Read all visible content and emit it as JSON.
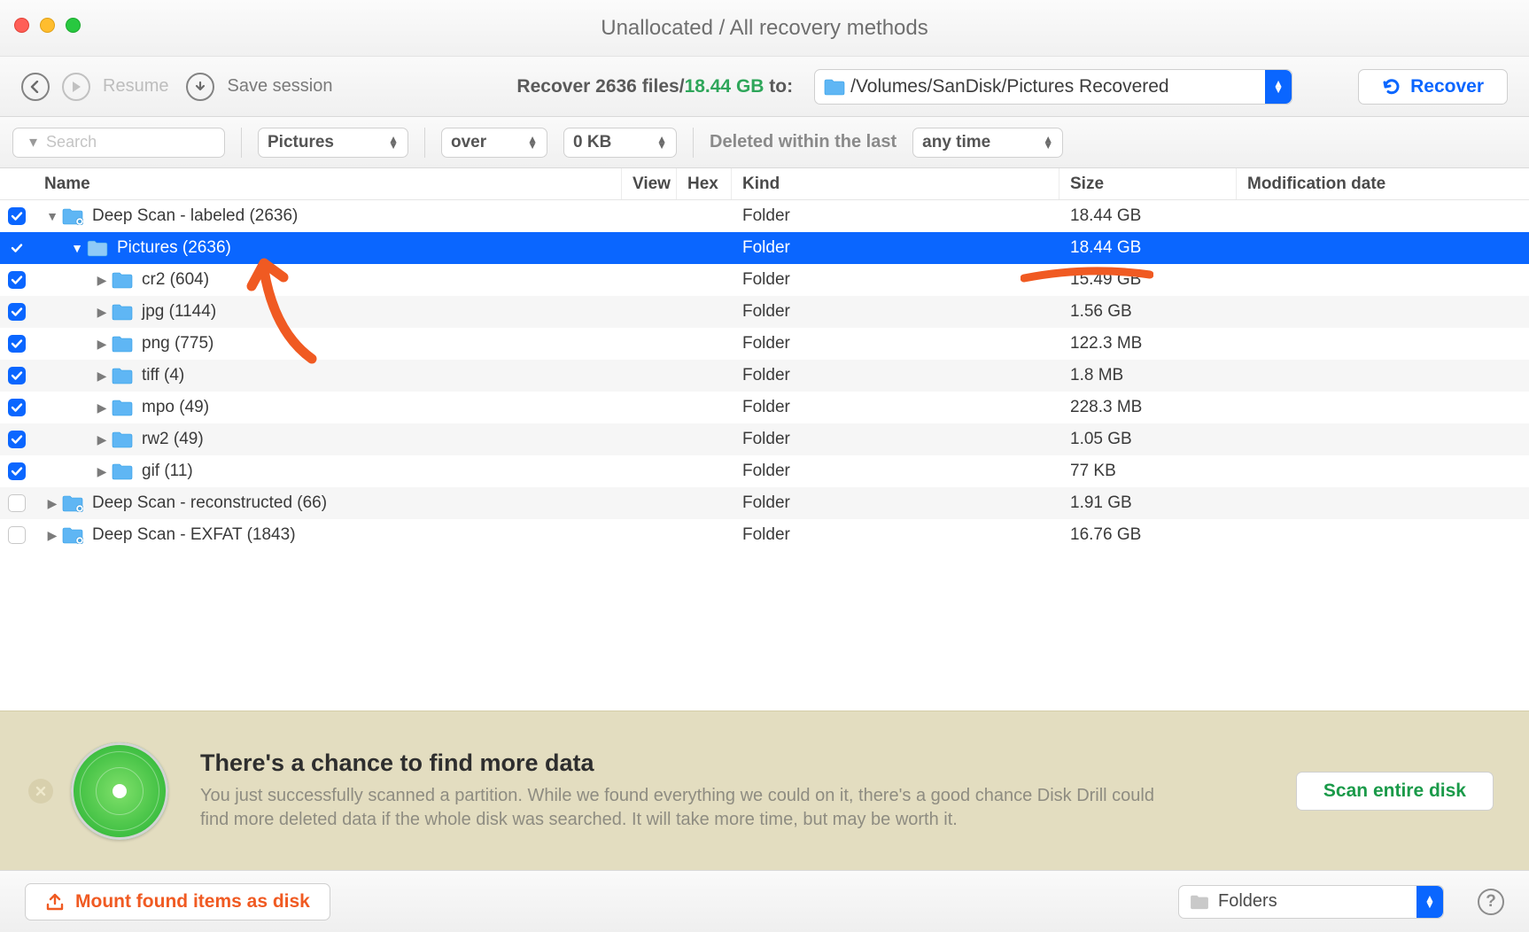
{
  "window": {
    "title": "Unallocated / All recovery methods"
  },
  "toolbar": {
    "resume_label": "Resume",
    "save_session_label": "Save session",
    "recover_prefix": "Recover ",
    "recover_count": "2636",
    "recover_mid": " files/",
    "recover_size": "18.44 GB",
    "recover_suffix": " to:",
    "dest_path": "/Volumes/SanDisk/Pictures Recovered",
    "recover_btn": "Recover"
  },
  "filters": {
    "search_placeholder": "Search",
    "type_selected": "Pictures",
    "size_op": "over",
    "size_val": "0 KB",
    "deleted_label": "Deleted within the last",
    "time_selected": "any time"
  },
  "columns": {
    "name": "Name",
    "view": "View",
    "hex": "Hex",
    "kind": "Kind",
    "size": "Size",
    "mod": "Modification date"
  },
  "rows": [
    {
      "checked": true,
      "depth": 0,
      "expanded": true,
      "selected": false,
      "badge": true,
      "name": "Deep Scan - labeled (2636)",
      "kind": "Folder",
      "size": "18.44 GB"
    },
    {
      "checked": true,
      "depth": 1,
      "expanded": true,
      "selected": true,
      "badge": false,
      "name": "Pictures (2636)",
      "kind": "Folder",
      "size": "18.44 GB"
    },
    {
      "checked": true,
      "depth": 2,
      "expanded": false,
      "selected": false,
      "badge": false,
      "name": "cr2 (604)",
      "kind": "Folder",
      "size": "15.49 GB"
    },
    {
      "checked": true,
      "depth": 2,
      "expanded": false,
      "selected": false,
      "badge": false,
      "name": "jpg (1144)",
      "kind": "Folder",
      "size": "1.56 GB"
    },
    {
      "checked": true,
      "depth": 2,
      "expanded": false,
      "selected": false,
      "badge": false,
      "name": "png (775)",
      "kind": "Folder",
      "size": "122.3 MB"
    },
    {
      "checked": true,
      "depth": 2,
      "expanded": false,
      "selected": false,
      "badge": false,
      "name": "tiff (4)",
      "kind": "Folder",
      "size": "1.8 MB"
    },
    {
      "checked": true,
      "depth": 2,
      "expanded": false,
      "selected": false,
      "badge": false,
      "name": "mpo (49)",
      "kind": "Folder",
      "size": "228.3 MB"
    },
    {
      "checked": true,
      "depth": 2,
      "expanded": false,
      "selected": false,
      "badge": false,
      "name": "rw2 (49)",
      "kind": "Folder",
      "size": "1.05 GB"
    },
    {
      "checked": true,
      "depth": 2,
      "expanded": false,
      "selected": false,
      "badge": false,
      "name": "gif (11)",
      "kind": "Folder",
      "size": "77 KB"
    },
    {
      "checked": false,
      "depth": 0,
      "expanded": false,
      "selected": false,
      "badge": true,
      "name": "Deep Scan - reconstructed (66)",
      "kind": "Folder",
      "size": "1.91 GB"
    },
    {
      "checked": false,
      "depth": 0,
      "expanded": false,
      "selected": false,
      "badge": true,
      "name": "Deep Scan - EXFAT (1843)",
      "kind": "Folder",
      "size": "16.76 GB"
    }
  ],
  "banner": {
    "heading": "There's a chance to find more data",
    "body": "You just successfully scanned a partition. While we found everything we could on it, there's a good chance Disk Drill could find more deleted data if the whole disk was searched. It will take more time, but may be worth it.",
    "cta": "Scan entire disk"
  },
  "bottom": {
    "mount_label": "Mount found items as disk",
    "view_selected": "Folders"
  }
}
